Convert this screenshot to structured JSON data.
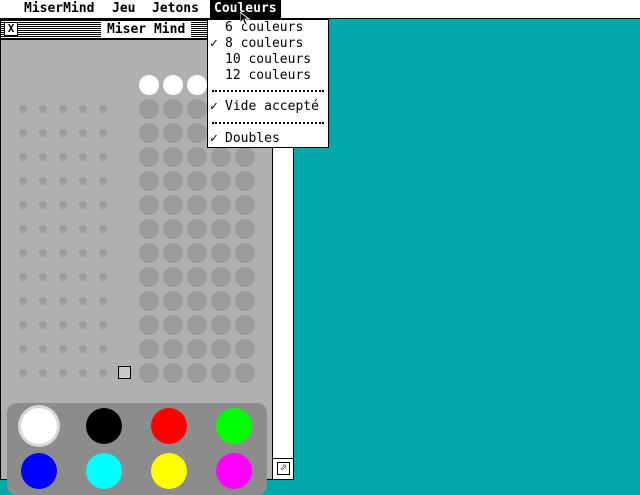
{
  "menubar": {
    "items": [
      {
        "label": "MiserMind"
      },
      {
        "label": "Jeu"
      },
      {
        "label": "Jetons"
      },
      {
        "label": "Couleurs",
        "active": true
      }
    ]
  },
  "window": {
    "title": "Miser Mind",
    "close_glyph": "X",
    "size_glyph": "⬀"
  },
  "colors_menu": {
    "items": [
      {
        "label": "6 couleurs",
        "checked": false
      },
      {
        "label": "8 couleurs",
        "checked": true
      },
      {
        "label": "10 couleurs",
        "checked": false
      },
      {
        "label": "12 couleurs",
        "checked": false
      },
      {
        "label": "Vide accepté",
        "checked": true
      },
      {
        "label": "Doubles",
        "checked": true
      }
    ],
    "check_glyph": "✓"
  },
  "board": {
    "rows": 12,
    "pegs_per_row": 5,
    "visible_secret_pegs": 3
  },
  "palette": {
    "colors": [
      {
        "name": "white",
        "hex": "#ffffff",
        "selected": true
      },
      {
        "name": "black",
        "hex": "#000000"
      },
      {
        "name": "red",
        "hex": "#ff0000"
      },
      {
        "name": "green",
        "hex": "#00ff00"
      },
      {
        "name": "blue",
        "hex": "#0000ff"
      },
      {
        "name": "cyan",
        "hex": "#00ffff"
      },
      {
        "name": "yellow",
        "hex": "#ffff00"
      },
      {
        "name": "magenta",
        "hex": "#ff00ff"
      }
    ]
  },
  "desktop": {
    "color": "#00a8a8"
  }
}
